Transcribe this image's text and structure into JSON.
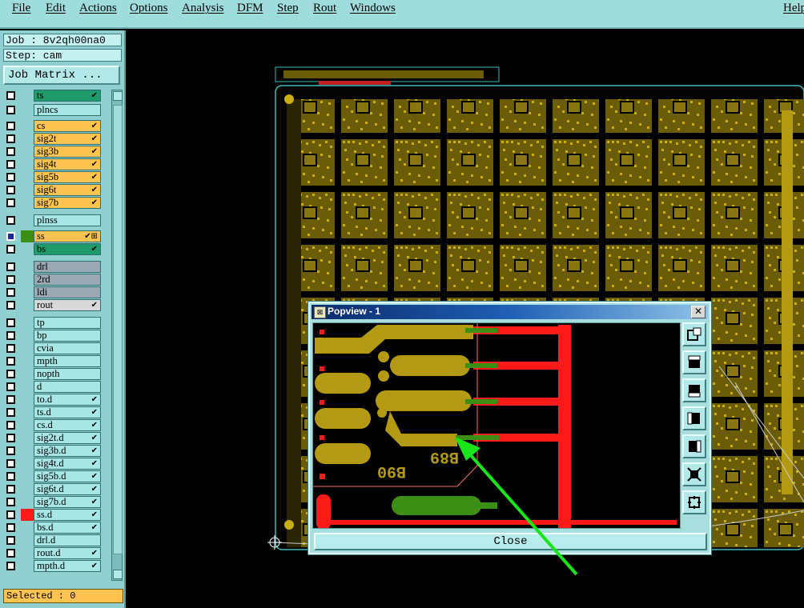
{
  "menubar": {
    "items": [
      "File",
      "Edit",
      "Actions",
      "Options",
      "Analysis",
      "DFM",
      "Step",
      "Rout",
      "Windows"
    ],
    "help": "Help"
  },
  "info": {
    "job": "Job : 8v2qh00na0",
    "step": "Step: cam"
  },
  "job_matrix_label": "Job Matrix ...",
  "layers": [
    {
      "name": "ts",
      "color": "#1f9a6a",
      "mark": "✔"
    },
    {
      "name": "plncs",
      "color": "#a8e6e6",
      "mark": ""
    },
    {
      "name": "cs",
      "color": "#ffc44f",
      "mark": "✔"
    },
    {
      "name": "sig2t",
      "color": "#ffc44f",
      "mark": "✔"
    },
    {
      "name": "sig3b",
      "color": "#ffc44f",
      "mark": "✔"
    },
    {
      "name": "sig4t",
      "color": "#ffc44f",
      "mark": "✔"
    },
    {
      "name": "sig5b",
      "color": "#ffc44f",
      "mark": "✔"
    },
    {
      "name": "sig6t",
      "color": "#ffc44f",
      "mark": "✔"
    },
    {
      "name": "sig7b",
      "color": "#ffc44f",
      "mark": "✔"
    },
    {
      "name": "plnss",
      "color": "#a8e6e6",
      "mark": ""
    },
    {
      "name": "ss",
      "color": "#ffc44f",
      "mark": "✔⊞"
    },
    {
      "name": "bs",
      "color": "#1f9a6a",
      "mark": "✔"
    },
    {
      "name": "drl",
      "color": "#9aa8b4",
      "mark": ""
    },
    {
      "name": "2rd",
      "color": "#9aa8b4",
      "mark": ""
    },
    {
      "name": "ldi",
      "color": "#9aa8b4",
      "mark": ""
    },
    {
      "name": "rout",
      "color": "#d8d8d8",
      "mark": "✔"
    },
    {
      "name": "tp",
      "color": "#a8e6e6",
      "mark": ""
    },
    {
      "name": "bp",
      "color": "#a8e6e6",
      "mark": ""
    },
    {
      "name": "cvia",
      "color": "#a8e6e6",
      "mark": ""
    },
    {
      "name": "mpth",
      "color": "#a8e6e6",
      "mark": ""
    },
    {
      "name": "nopth",
      "color": "#a8e6e6",
      "mark": ""
    },
    {
      "name": "d",
      "color": "#a8e6e6",
      "mark": ""
    },
    {
      "name": "to.d",
      "color": "#a8e6e6",
      "mark": "✔"
    },
    {
      "name": "ts.d",
      "color": "#a8e6e6",
      "mark": "✔"
    },
    {
      "name": "cs.d",
      "color": "#a8e6e6",
      "mark": "✔"
    },
    {
      "name": "sig2t.d",
      "color": "#a8e6e6",
      "mark": "✔"
    },
    {
      "name": "sig3b.d",
      "color": "#a8e6e6",
      "mark": "✔"
    },
    {
      "name": "sig4t.d",
      "color": "#a8e6e6",
      "mark": "✔"
    },
    {
      "name": "sig5b.d",
      "color": "#a8e6e6",
      "mark": "✔"
    },
    {
      "name": "sig6t.d",
      "color": "#a8e6e6",
      "mark": "✔"
    },
    {
      "name": "sig7b.d",
      "color": "#a8e6e6",
      "mark": "✔"
    },
    {
      "name": "ss.d",
      "color": "#a8e6e6",
      "mark": "✔"
    },
    {
      "name": "bs.d",
      "color": "#a8e6e6",
      "mark": "✔"
    },
    {
      "name": "drl.d",
      "color": "#a8e6e6",
      "mark": ""
    },
    {
      "name": "rout.d",
      "color": "#a8e6e6",
      "mark": "✔"
    },
    {
      "name": "mpth.d",
      "color": "#a8e6e6",
      "mark": "✔"
    }
  ],
  "selected_text": "Selected : 0",
  "popup": {
    "title": "Popview - 1",
    "close_x": "✕",
    "close_label": "Close",
    "silkscreen_1": "B90",
    "silkscreen_2": "B89",
    "tools": [
      "zoom-fit-icon",
      "pan-up-icon",
      "pan-down-icon",
      "pan-left-icon",
      "pan-right-icon",
      "zoom-in-icon",
      "zoom-out-icon"
    ]
  },
  "colors": {
    "copper": "#b39a12",
    "trace_red": "#ff1a1a",
    "pad_green": "#3c8f14",
    "arrow": "#19e619",
    "panel_teal": "#8fcfcf",
    "selected_orange": "#ffc44f"
  }
}
